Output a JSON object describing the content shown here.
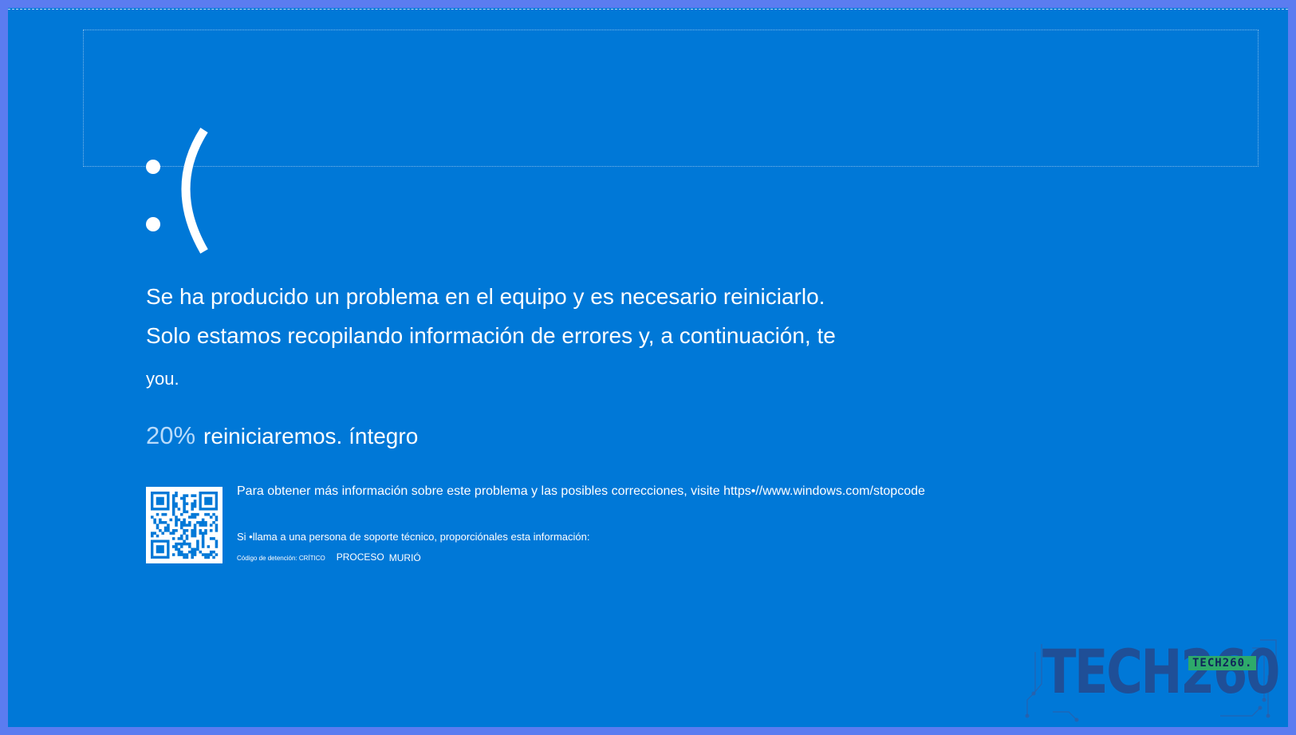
{
  "screen": {
    "face": ":(",
    "message_line1": "Se ha producido un problema en el equipo y es necesario reiniciarlo.",
    "message_line2": "Solo estamos recopilando información de errores y, a continuación, te",
    "message_line3": "you.",
    "progress_percent": "20%",
    "progress_text": "reiniciaremos. íntegro",
    "info_more": "Para obtener más información sobre este problema y las posibles correcciones, visite https•//www.windows.com/stopcode",
    "info_support": "Si •llama a una persona de soporte técnico, proporciónales esta información:",
    "stop_code_label": "Código de detención: CRÍTICO",
    "stop_code_value_1": "PROCESO",
    "stop_code_value_2": "MURIÓ"
  },
  "watermark": {
    "logo_text": "TECH260",
    "badge_text": "TECH260."
  },
  "colors": {
    "bsod_blue": "#0078d7",
    "frame": "#5b7cf0",
    "percent_text": "#b9dcfb"
  }
}
